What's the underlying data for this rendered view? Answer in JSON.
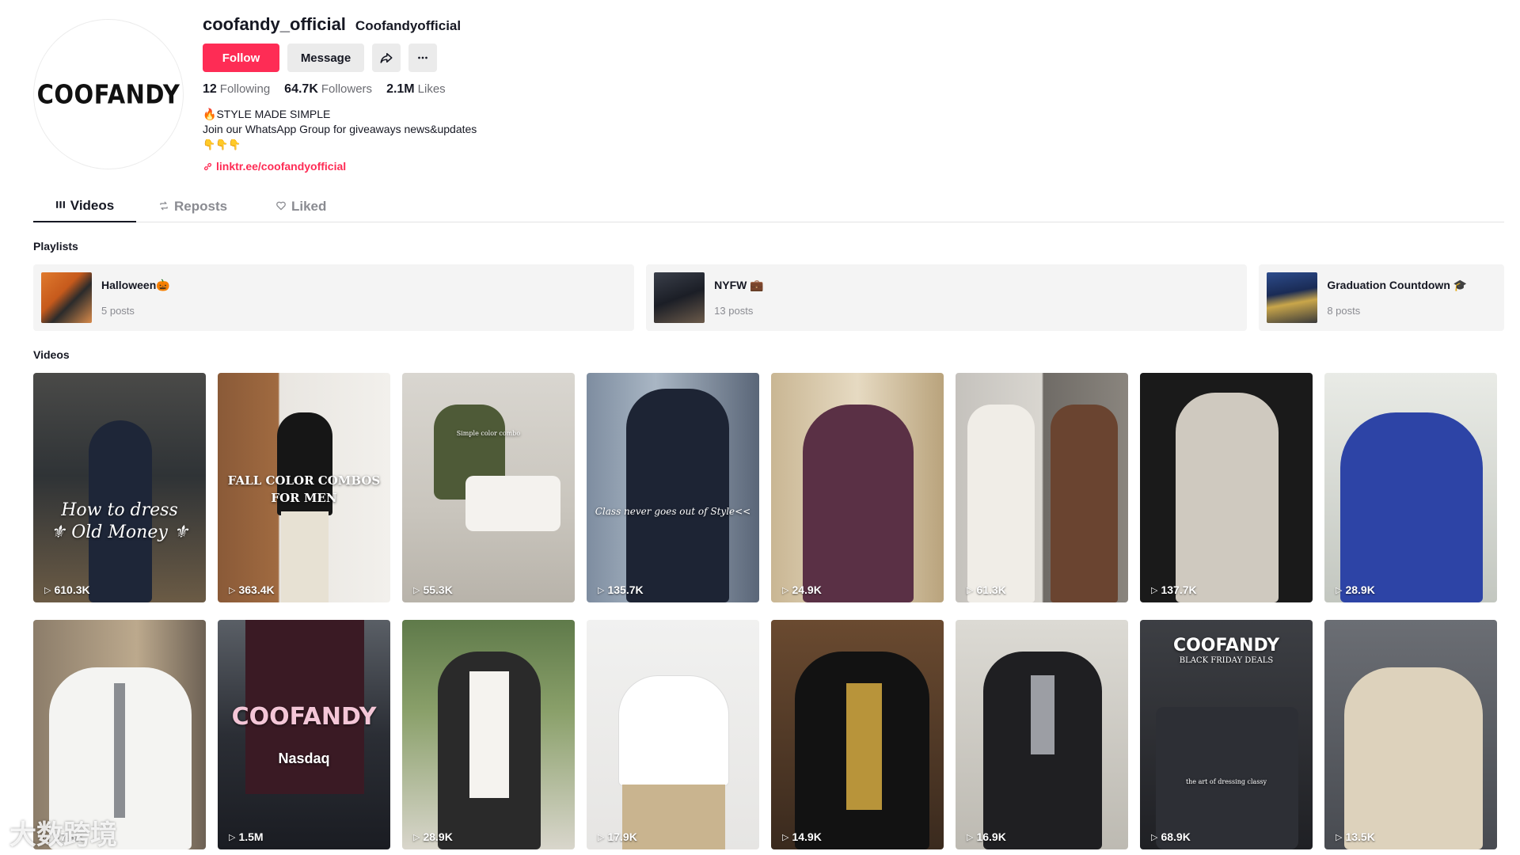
{
  "profile": {
    "avatar_logo": "COOFANDY",
    "username": "coofandy_official",
    "nickname": "Coofandyofficial",
    "buttons": {
      "follow": "Follow",
      "message": "Message"
    },
    "stats": [
      {
        "value": "12",
        "label": "Following"
      },
      {
        "value": "64.7K",
        "label": "Followers"
      },
      {
        "value": "2.1M",
        "label": "Likes"
      }
    ],
    "bio_line1": "STYLE MADE SIMPLE",
    "bio_line2": "Join our WhatsApp Group for giveaways news&updates",
    "bio_emojis": "👇👇👇",
    "link": "linktr.ee/coofandyofficial"
  },
  "tabs": [
    {
      "label": "Videos",
      "icon": "grid-icon"
    },
    {
      "label": "Reposts",
      "icon": "repost-icon"
    },
    {
      "label": "Liked",
      "icon": "heart-outline-icon"
    }
  ],
  "playlists_label": "Playlists",
  "playlists": [
    {
      "title": "Halloween🎃",
      "count": "5 posts"
    },
    {
      "title": "NYFW 💼",
      "count": "13 posts"
    },
    {
      "title": "Graduation Countdown 🎓",
      "count": "8 posts"
    }
  ],
  "videos_label": "Videos",
  "videos": [
    {
      "views": "610.3K",
      "overlay": "How to dress\n⚜ Old Money ⚜"
    },
    {
      "views": "363.4K",
      "overlay": "FALL COLOR COMBOS\nFOR MEN"
    },
    {
      "views": "55.3K",
      "overlay": "Simple color combo"
    },
    {
      "views": "135.7K",
      "overlay": "Class never goes out of Style<<"
    },
    {
      "views": "24.9K",
      "overlay": ""
    },
    {
      "views": "61.3K",
      "overlay": ""
    },
    {
      "views": "137.7K",
      "overlay": ""
    },
    {
      "views": "28.9K",
      "overlay": ""
    },
    {
      "views": "27.6K",
      "overlay": ""
    },
    {
      "views": "1.5M",
      "overlay": "COOFANDY"
    },
    {
      "views": "28.9K",
      "overlay": ""
    },
    {
      "views": "17.9K",
      "overlay": ""
    },
    {
      "views": "14.9K",
      "overlay": ""
    },
    {
      "views": "16.9K",
      "overlay": ""
    },
    {
      "views": "68.9K",
      "overlay": "COOFANDY"
    },
    {
      "views": "13.5K",
      "overlay": ""
    }
  ],
  "video_extra_text": {
    "v10_nasdaq": "Nasdaq",
    "v15_sub": "BLACK FRIDAY DEALS",
    "v15_caption": "the art of dressing classy"
  },
  "watermark": "大数跨境",
  "colors": {
    "accent": "#fe2c55",
    "text": "#161823",
    "muted": "#8a8b91"
  }
}
